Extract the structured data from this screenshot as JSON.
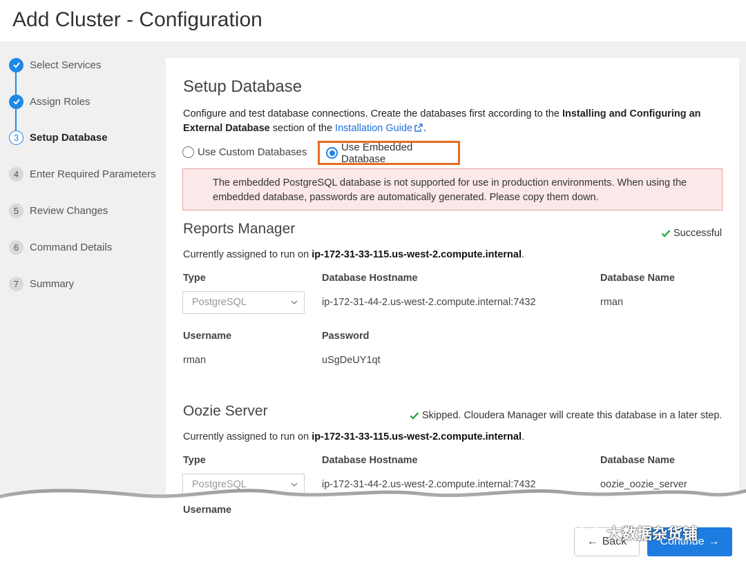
{
  "page": {
    "title": "Add Cluster - Configuration"
  },
  "steps": [
    {
      "number": "1",
      "label": "Select Services",
      "state": "done"
    },
    {
      "number": "2",
      "label": "Assign Roles",
      "state": "done"
    },
    {
      "number": "3",
      "label": "Setup Database",
      "state": "current"
    },
    {
      "number": "4",
      "label": "Enter Required Parameters",
      "state": "pending"
    },
    {
      "number": "5",
      "label": "Review Changes",
      "state": "pending"
    },
    {
      "number": "6",
      "label": "Command Details",
      "state": "pending"
    },
    {
      "number": "7",
      "label": "Summary",
      "state": "pending"
    }
  ],
  "setup": {
    "heading": "Setup Database",
    "desc_part1": "Configure and test database connections. Create the databases first according to the ",
    "desc_bold1": "Installing and Configuring an External Database",
    "desc_part2": " section of the ",
    "desc_link": "Installation Guide",
    "desc_end": ".",
    "radio_custom": "Use Custom Databases",
    "radio_embedded": "Use Embedded Database",
    "selected_option": "Use Embedded Database",
    "alert": "The embedded PostgreSQL database is not supported for use in production environments. When using the embedded database, passwords are automatically generated. Please copy them down."
  },
  "reports_manager": {
    "heading": "Reports Manager",
    "status": "Successful",
    "assigned_prefix": "Currently assigned to run on ",
    "host": "ip-172-31-33-115.us-west-2.compute.internal",
    "assigned_suffix": ".",
    "type_label": "Type",
    "type_value": "PostgreSQL",
    "hostname_label": "Database Hostname",
    "hostname_value": "ip-172-31-44-2.us-west-2.compute.internal:7432",
    "dbname_label": "Database Name",
    "dbname_value": "rman",
    "username_label": "Username",
    "username_value": "rman",
    "password_label": "Password",
    "password_value": "uSgDeUY1qt"
  },
  "oozie_server": {
    "heading": "Oozie Server",
    "status": "Skipped. Cloudera Manager will create this database in a later step.",
    "assigned_prefix": "Currently assigned to run on ",
    "host": "ip-172-31-33-115.us-west-2.compute.internal",
    "assigned_suffix": ".",
    "type_label": "Type",
    "type_value": "PostgreSQL",
    "hostname_label": "Database Hostname",
    "hostname_value": "ip-172-31-44-2.us-west-2.compute.internal:7432",
    "dbname_label": "Database Name",
    "dbname_value": "oozie_oozie_server",
    "username_label": "Username"
  },
  "footer": {
    "back_label": "Back",
    "continue_label": "Continue",
    "watermark": "大数据杂货铺"
  },
  "colors": {
    "accent": "#1e88e5",
    "highlight_border": "#e46c20",
    "alert_bg": "#fbe8e8",
    "success": "#2eaa4a"
  },
  "icons": [
    "check-icon",
    "external-link-icon",
    "chevron-down-icon",
    "arrow-left-icon",
    "arrow-right-icon",
    "wechat-icon"
  ]
}
